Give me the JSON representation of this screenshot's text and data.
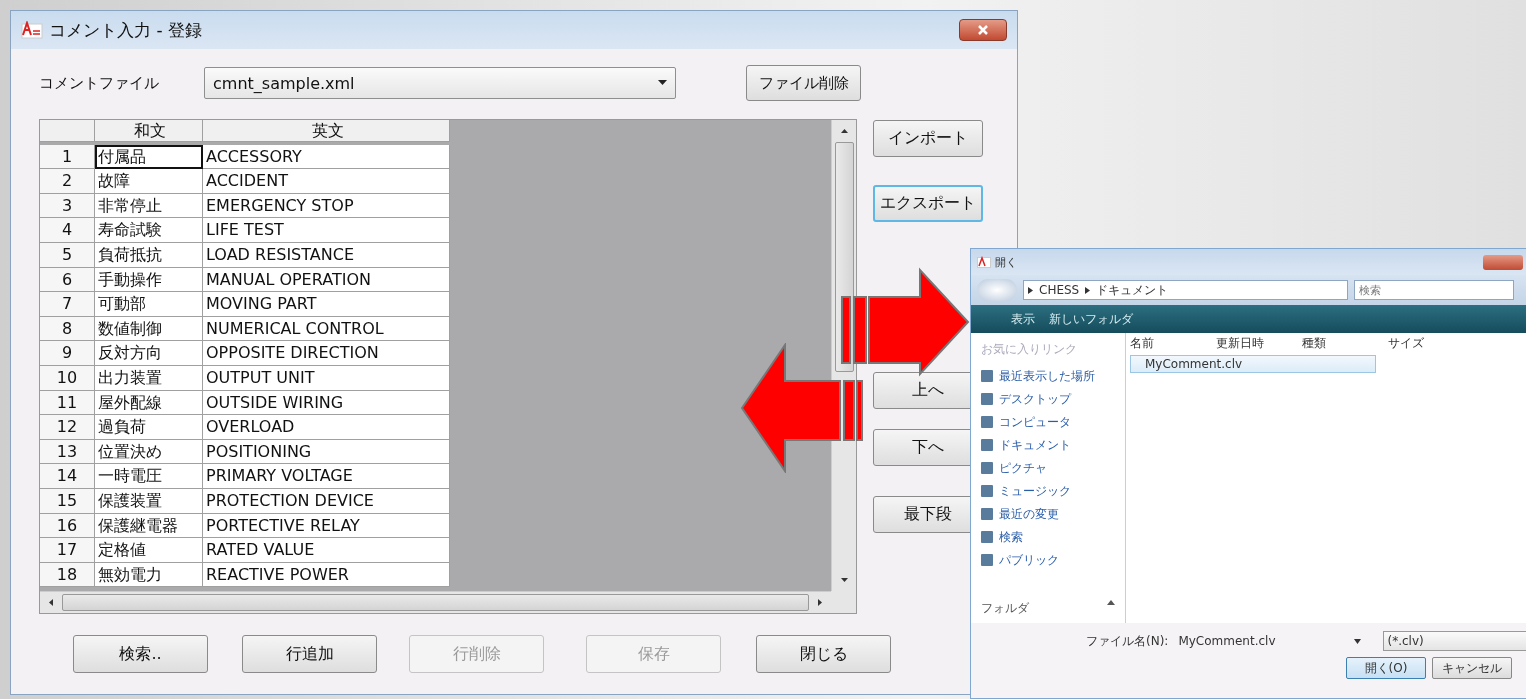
{
  "window": {
    "title": "コメント入力 - 登録"
  },
  "comment_file": {
    "label": "コメントファイル",
    "value": "cmnt_sample.xml",
    "delete_button": "ファイル削除"
  },
  "table": {
    "columns": [
      "和文",
      "英文"
    ],
    "rows": [
      {
        "no": "1",
        "ja": "付属品",
        "en": "ACCESSORY",
        "current": true
      },
      {
        "no": "2",
        "ja": "故障",
        "en": "ACCIDENT",
        "current": false
      },
      {
        "no": "3",
        "ja": "非常停止",
        "en": "EMERGENCY STOP",
        "current": false
      },
      {
        "no": "4",
        "ja": "寿命試験",
        "en": "LIFE TEST",
        "current": false
      },
      {
        "no": "5",
        "ja": "負荷抵抗",
        "en": "LOAD RESISTANCE",
        "current": false
      },
      {
        "no": "6",
        "ja": "手動操作",
        "en": "MANUAL OPERATION",
        "current": false
      },
      {
        "no": "7",
        "ja": "可動部",
        "en": "MOVING PART",
        "current": false
      },
      {
        "no": "8",
        "ja": "数値制御",
        "en": "NUMERICAL CONTROL",
        "current": false
      },
      {
        "no": "9",
        "ja": "反対方向",
        "en": "OPPOSITE DIRECTION",
        "current": false
      },
      {
        "no": "10",
        "ja": "出力装置",
        "en": "OUTPUT UNIT",
        "current": false
      },
      {
        "no": "11",
        "ja": "屋外配線",
        "en": "OUTSIDE WIRING",
        "current": false
      },
      {
        "no": "12",
        "ja": "過負荷",
        "en": "OVERLOAD",
        "current": false
      },
      {
        "no": "13",
        "ja": "位置決め",
        "en": "POSITIONING",
        "current": false
      },
      {
        "no": "14",
        "ja": "一時電圧",
        "en": "PRIMARY VOLTAGE",
        "current": false
      },
      {
        "no": "15",
        "ja": "保護装置",
        "en": "PROTECTION DEVICE",
        "current": false
      },
      {
        "no": "16",
        "ja": "保護継電器",
        "en": "PORTECTIVE RELAY",
        "current": false
      },
      {
        "no": "17",
        "ja": "定格値",
        "en": "RATED VALUE",
        "current": false
      },
      {
        "no": "18",
        "ja": "無効電力",
        "en": "REACTIVE POWER",
        "current": false
      }
    ]
  },
  "side_buttons": [
    {
      "label": "インポート",
      "focused": false
    },
    {
      "label": "エクスポート",
      "focused": true
    },
    {
      "label": "上へ",
      "focused": false
    },
    {
      "label": "下へ",
      "focused": false
    },
    {
      "label": "最下段",
      "focused": false
    }
  ],
  "bottom_buttons": [
    {
      "label": "検索..",
      "disabled": false
    },
    {
      "label": "行追加",
      "disabled": false
    },
    {
      "label": "行削除",
      "disabled": true
    },
    {
      "label": "保存",
      "disabled": true
    },
    {
      "label": "閉じる",
      "disabled": false
    }
  ],
  "open_dialog": {
    "title": "開く",
    "path": [
      "CHESS",
      "ドキュメント"
    ],
    "search_placeholder": "検索",
    "toolbar": [
      "表示",
      "新しいフォルダ"
    ],
    "favorites_heading": "お気に入りリンク",
    "places": [
      "最近表示した場所",
      "デスクトップ",
      "コンピュータ",
      "ドキュメント",
      "ピクチャ",
      "ミュージック",
      "最近の変更",
      "検索",
      "パブリック"
    ],
    "folders_label": "フォルダ",
    "columns": [
      "名前",
      "更新日時",
      "種類",
      "サイズ"
    ],
    "files": [
      {
        "name": "MyComment.clv",
        "selected": true
      }
    ],
    "filename_label": "ファイル名(N):",
    "filename": "MyComment.clv",
    "filter": "(*.clv)",
    "buttons": [
      "開く(O)",
      "キャンセル"
    ]
  },
  "arrows": [
    {
      "kind": "right"
    },
    {
      "kind": "left"
    }
  ]
}
